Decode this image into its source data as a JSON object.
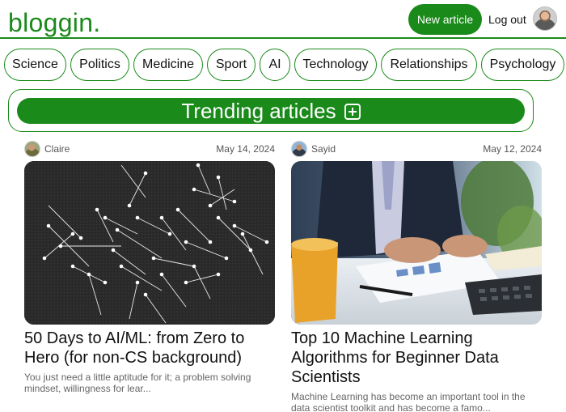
{
  "header": {
    "logo": "bloggin.",
    "new_article_label": "New article",
    "logout_label": "Log out"
  },
  "categories": [
    {
      "label": "Science"
    },
    {
      "label": "Politics"
    },
    {
      "label": "Medicine"
    },
    {
      "label": "Sport"
    },
    {
      "label": "AI"
    },
    {
      "label": "Technology"
    },
    {
      "label": "Relationships"
    },
    {
      "label": "Psychology"
    }
  ],
  "trending": {
    "label": "Trending articles",
    "icon": "plus-square-icon"
  },
  "articles": [
    {
      "author": "Claire",
      "date": "May 14, 2024",
      "title": "50 Days to AI/ML: from Zero to Hero (for non-CS background)",
      "excerpt": "You just need a little aptitude for it; a problem solving mindset, willingness for lear..."
    },
    {
      "author": "Sayid",
      "date": "May 12, 2024",
      "title": "Top 10 Machine Learning Algorithms for Beginner Data Scientists",
      "excerpt": "Machine Learning has become an important tool in the data scientist toolkit and has become a famo..."
    }
  ],
  "colors": {
    "brand": "#1a8a1a",
    "text": "#111111",
    "muted": "#666666"
  }
}
